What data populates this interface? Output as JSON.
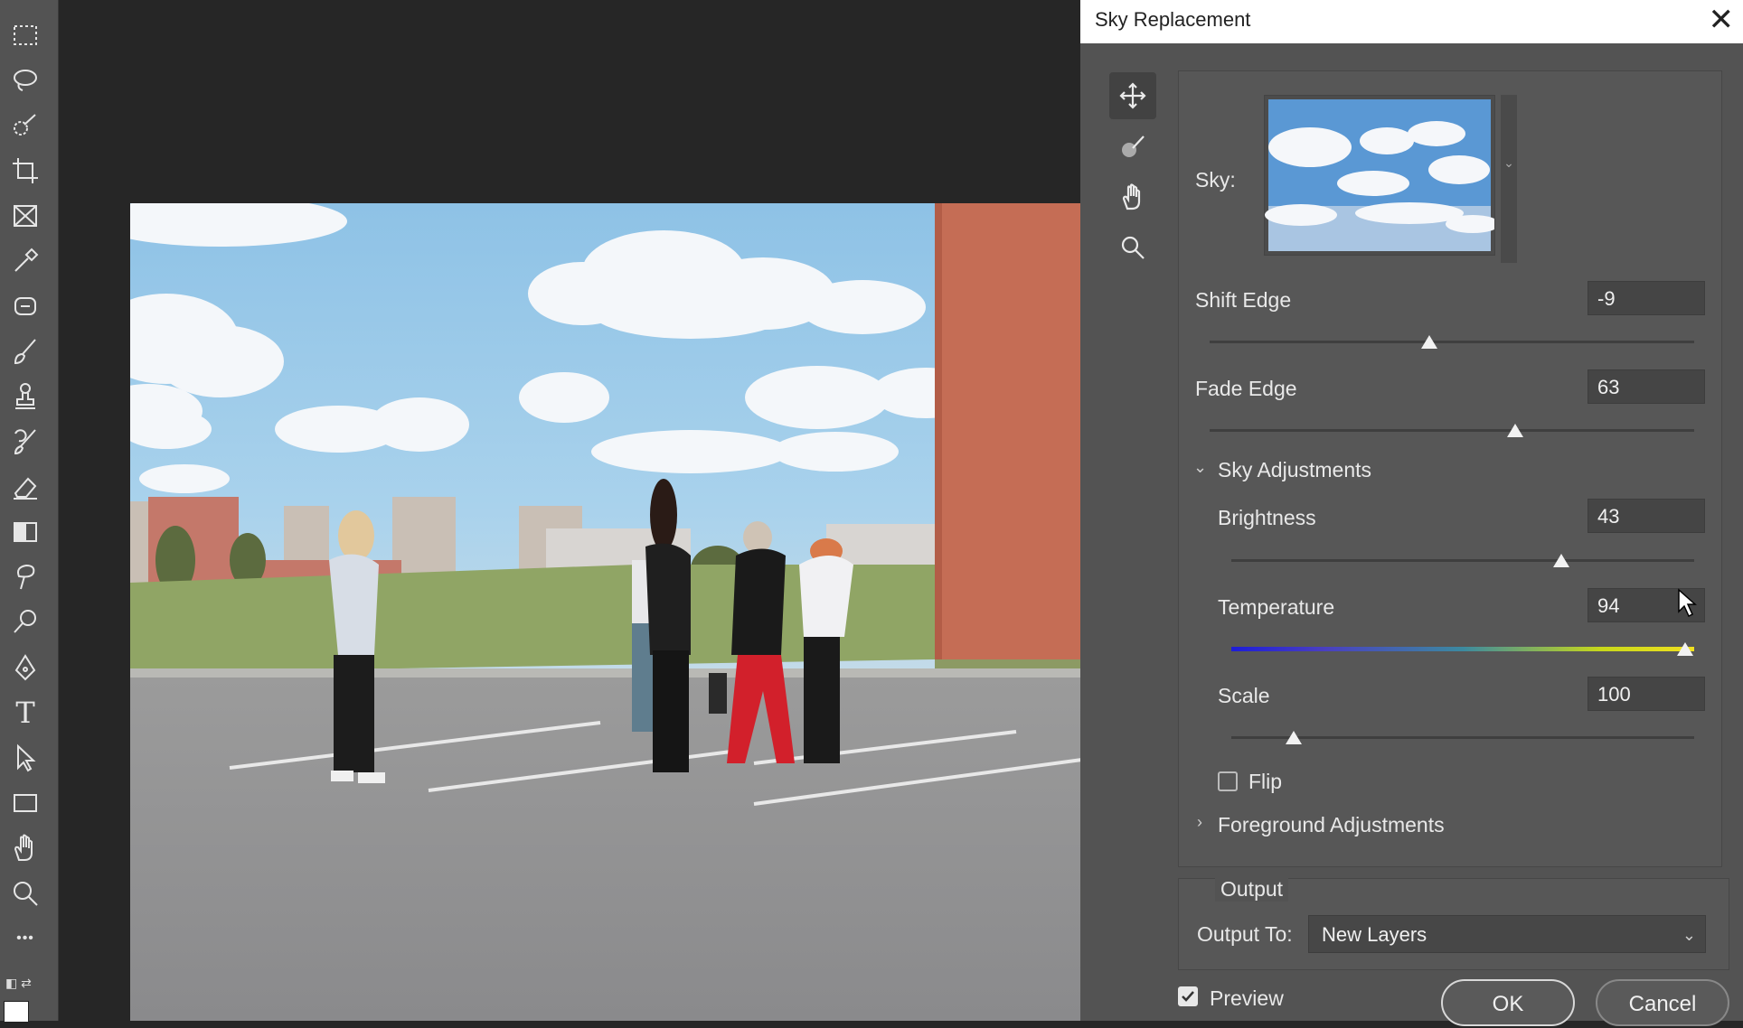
{
  "toolbar": {
    "tools": [
      "marquee-icon",
      "lasso-icon",
      "quick-select-icon",
      "crop-icon",
      "frame-icon",
      "eyedropper-icon",
      "patch-icon",
      "brush-icon",
      "stamp-icon",
      "history-brush-icon",
      "eraser-icon",
      "gradient-icon",
      "smudge-icon",
      "dodge-icon",
      "pen-icon",
      "type-icon",
      "path-select-icon",
      "rectangle-icon",
      "hand-icon",
      "zoom-icon",
      "more-icon"
    ],
    "type_glyph": "T",
    "more_glyph": "•••"
  },
  "dialog": {
    "title": "Sky Replacement",
    "close_glyph": "✕",
    "tools": [
      "move-sky-icon",
      "sky-brush-icon",
      "hand-icon",
      "zoom-icon"
    ],
    "sky_label": "Sky:",
    "sliders": {
      "shift_edge": {
        "label": "Shift Edge",
        "value": "-9",
        "position": 0.45
      },
      "fade_edge": {
        "label": "Fade Edge",
        "value": "63",
        "position": 0.63
      },
      "brightness": {
        "label": "Brightness",
        "value": "43",
        "position": 0.71
      },
      "temperature": {
        "label": "Temperature",
        "value": "94",
        "position": 0.97
      },
      "scale": {
        "label": "Scale",
        "value": "100",
        "position": 0.14
      }
    },
    "sky_adjustments": "Sky Adjustments",
    "flip_label": "Flip",
    "foreground_adjustments": "Foreground Adjustments",
    "output": {
      "group_label": "Output",
      "output_to_label": "Output To:",
      "output_to_value": "New Layers"
    },
    "preview_label": "Preview",
    "preview_checked": true,
    "ok_label": "OK",
    "cancel_label": "Cancel"
  },
  "colors": {
    "panel": "#535353",
    "temperature_gradient": [
      "#1d1dd8",
      "#2a8a8a",
      "#c8d81a",
      "#f0e020"
    ]
  }
}
